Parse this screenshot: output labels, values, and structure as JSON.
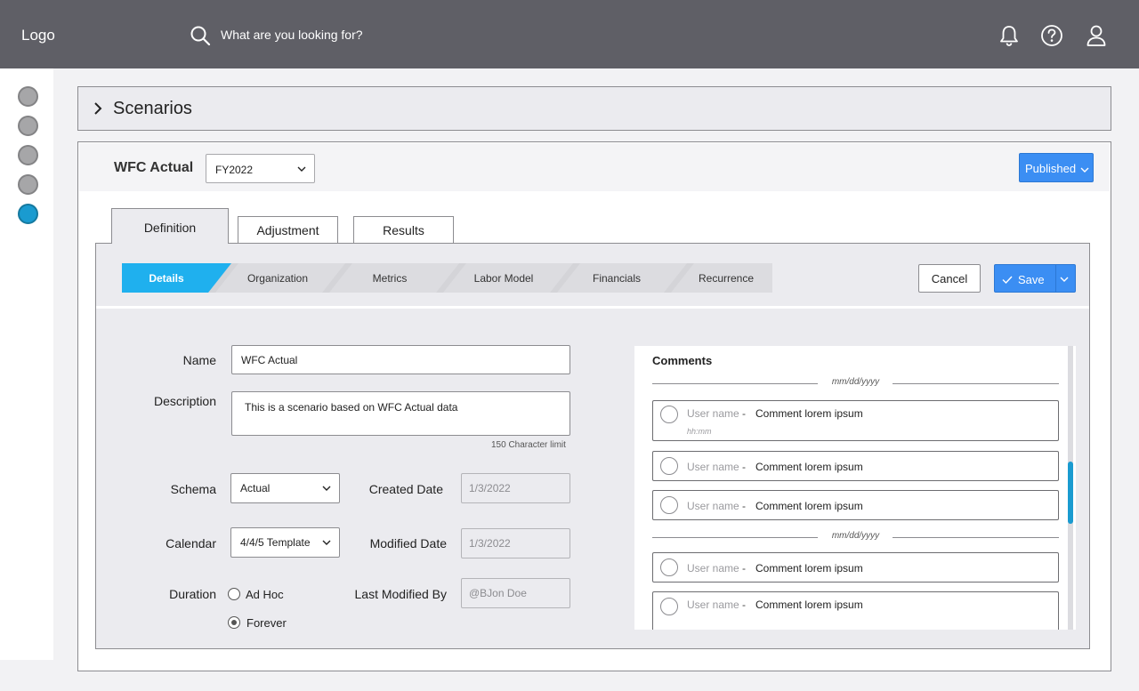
{
  "header": {
    "logo": "Logo",
    "search_placeholder": "What are you looking for?",
    "icons": [
      "bell-icon",
      "help-icon",
      "user-icon"
    ]
  },
  "sidebar": {
    "items": [
      "nav-item-1",
      "nav-item-2",
      "nav-item-3",
      "nav-item-4",
      "nav-item-5"
    ],
    "active_index": 4
  },
  "scenarios": {
    "title": "Scenarios"
  },
  "panel": {
    "title": "WFC Actual",
    "year_select": "FY2022",
    "status": "Published"
  },
  "tabs": [
    {
      "label": "Definition",
      "active": true
    },
    {
      "label": "Adjustment",
      "active": false
    },
    {
      "label": "Results",
      "active": false
    }
  ],
  "steps": [
    "Details",
    "Organization",
    "Metrics",
    "Labor Model",
    "Financials",
    "Recurrence"
  ],
  "actions": {
    "cancel": "Cancel",
    "save": "Save"
  },
  "form": {
    "name_label": "Name",
    "name_value": "WFC Actual",
    "description_label": "Description",
    "description_value": "This is a scenario based on WFC Actual data",
    "char_limit": "150 Character limit",
    "schema_label": "Schema",
    "schema_value": "Actual",
    "calendar_label": "Calendar",
    "calendar_value": "4/4/5 Template",
    "duration_label": "Duration",
    "duration_options": [
      "Ad Hoc",
      "Forever"
    ],
    "duration_selected": "Forever",
    "created_label": "Created Date",
    "created_value": "1/3/2022",
    "modified_label": "Modified Date",
    "modified_value": "1/3/2022",
    "last_modified_by_label": "Last Modified By",
    "last_modified_by_value": "@BJon Doe"
  },
  "comments": {
    "title": "Comments",
    "date_label": "mm/dd/yyyy",
    "time_label": "hh:mm",
    "user": "User name",
    "dash": "-",
    "text": "Comment lorem ipsum"
  },
  "colors": {
    "header_bg": "#5f5f66",
    "accent_blue": "#3b8ef3",
    "active_step": "#1fb0ee",
    "active_nav": "#1a9bd0",
    "panel_bg": "#ebebef"
  }
}
